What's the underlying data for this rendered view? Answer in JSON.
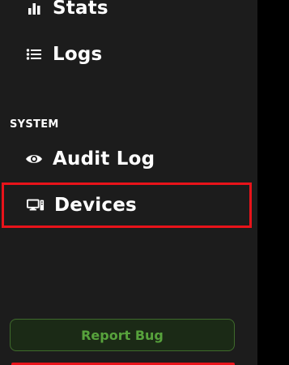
{
  "sidebar": {
    "items": [
      {
        "label": "Stats",
        "icon": "bar-chart-icon"
      },
      {
        "label": "Logs",
        "icon": "list-icon"
      }
    ],
    "sections": [
      {
        "title": "SYSTEM",
        "items": [
          {
            "label": "Audit Log",
            "icon": "eye-icon"
          },
          {
            "label": "Devices",
            "icon": "devices-icon",
            "highlighted": true
          }
        ]
      }
    ],
    "footer": {
      "report_bug_label": "Report Bug"
    }
  },
  "colors": {
    "sidebar_bg": "#1c1c1c",
    "highlight_border": "#e8131a",
    "report_bug_text": "#57a23c",
    "report_bug_bg": "#1b2a16"
  }
}
